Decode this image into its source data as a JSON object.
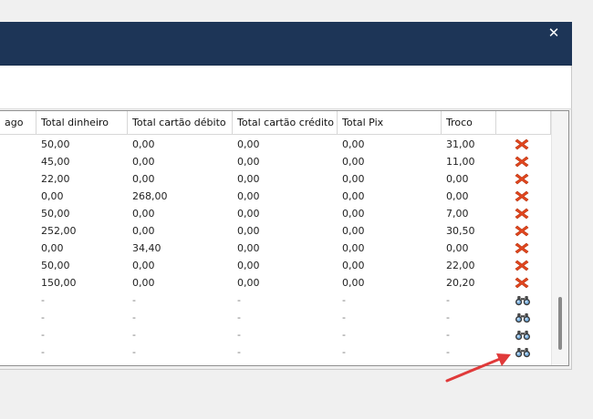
{
  "window": {
    "close_glyph": "✕",
    "titlebar_color": "#1d3557"
  },
  "grid": {
    "columns": [
      {
        "key": "pago",
        "label": "ago"
      },
      {
        "key": "dinheiro",
        "label": "Total dinheiro"
      },
      {
        "key": "debito",
        "label": "Total cartão débito"
      },
      {
        "key": "credito",
        "label": "Total cartão crédito"
      },
      {
        "key": "pix",
        "label": "Total Pix"
      },
      {
        "key": "troco",
        "label": "Troco"
      },
      {
        "key": "acao",
        "label": ""
      }
    ],
    "rows": [
      {
        "dinheiro": "50,00",
        "debito": "0,00",
        "credito": "0,00",
        "pix": "0,00",
        "troco": "31,00",
        "action_icon": "delete-x-icon"
      },
      {
        "dinheiro": "45,00",
        "debito": "0,00",
        "credito": "0,00",
        "pix": "0,00",
        "troco": "11,00",
        "action_icon": "delete-x-icon"
      },
      {
        "dinheiro": "22,00",
        "debito": "0,00",
        "credito": "0,00",
        "pix": "0,00",
        "troco": "0,00",
        "action_icon": "delete-x-icon"
      },
      {
        "dinheiro": "0,00",
        "debito": "268,00",
        "credito": "0,00",
        "pix": "0,00",
        "troco": "0,00",
        "action_icon": "delete-x-icon"
      },
      {
        "dinheiro": "50,00",
        "debito": "0,00",
        "credito": "0,00",
        "pix": "0,00",
        "troco": "7,00",
        "action_icon": "delete-x-icon"
      },
      {
        "dinheiro": "252,00",
        "debito": "0,00",
        "credito": "0,00",
        "pix": "0,00",
        "troco": "30,50",
        "action_icon": "delete-x-icon"
      },
      {
        "dinheiro": "0,00",
        "debito": "34,40",
        "credito": "0,00",
        "pix": "0,00",
        "troco": "0,00",
        "action_icon": "delete-x-icon"
      },
      {
        "dinheiro": "50,00",
        "debito": "0,00",
        "credito": "0,00",
        "pix": "0,00",
        "troco": "22,00",
        "action_icon": "delete-x-icon"
      },
      {
        "dinheiro": "150,00",
        "debito": "0,00",
        "credito": "0,00",
        "pix": "0,00",
        "troco": "20,20",
        "action_icon": "delete-x-icon"
      },
      {
        "dinheiro": "-",
        "debito": "-",
        "credito": "-",
        "pix": "-",
        "troco": "-",
        "action_icon": "binoculars-icon"
      },
      {
        "dinheiro": "-",
        "debito": "-",
        "credito": "-",
        "pix": "-",
        "troco": "-",
        "action_icon": "binoculars-icon"
      },
      {
        "dinheiro": "-",
        "debito": "-",
        "credito": "-",
        "pix": "-",
        "troco": "-",
        "action_icon": "binoculars-icon"
      },
      {
        "dinheiro": "-",
        "debito": "-",
        "credito": "-",
        "pix": "-",
        "troco": "-",
        "action_icon": "binoculars-icon"
      }
    ]
  },
  "colors": {
    "delete_icon": "#e2461f",
    "annotation_arrow": "#e03a3a"
  }
}
